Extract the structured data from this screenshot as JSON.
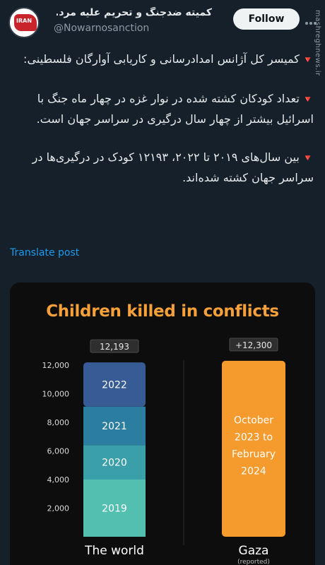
{
  "account": {
    "display_name": "کمیته ضدجنگ و تحریم علیه مرد...",
    "handle": "@Nowarnosanction",
    "avatar_text": "IRAN",
    "follow_label": "Follow"
  },
  "watermark": "mashreghnews.ir",
  "tweet": {
    "intro": "کمیسر کل آژانس امدادرسانی و کاریابی آوارگان فلسطینی:",
    "point1": "تعداد کودکان کشته شده در نوار غزه در چهار ماه جنگ با اسرائیل بیشتر از چهار سال درگیری در سراسر جهان است.",
    "point2": "بین سال‌های ۲۰۱۹ تا ۲۰۲۲، ۱۲۱۹۳ کودک در درگیری‌ها در سراسر جهان کشته شده‌اند.",
    "flag_glyph": "🔻"
  },
  "translate_label": "Translate post",
  "chart_data": {
    "type": "bar",
    "title": "Children killed in conflicts",
    "y_ticks": [
      "12,000",
      "10,000",
      "8,000",
      "6,000",
      "4,000",
      "2,000"
    ],
    "ylim": [
      0,
      12000
    ],
    "grid": false,
    "bars": [
      {
        "category": "The world",
        "total_label": "12,193",
        "total": 12193,
        "segments": [
          {
            "label": "2019",
            "value": 4000,
            "color": "#52bfb0"
          },
          {
            "label": "2020",
            "value": 2400,
            "color": "#3a9fa8"
          },
          {
            "label": "2021",
            "value": 2700,
            "color": "#2b7ea0"
          },
          {
            "label": "2022",
            "value": 3093,
            "color": "#375b95"
          }
        ]
      },
      {
        "category": "Gaza",
        "sublabel": "(reported)",
        "total_label": "+12,300",
        "total": 12300,
        "segments": [
          {
            "label": "October 2023 to February 2024",
            "value": 12300,
            "color": "#f59a2c"
          }
        ]
      }
    ]
  }
}
